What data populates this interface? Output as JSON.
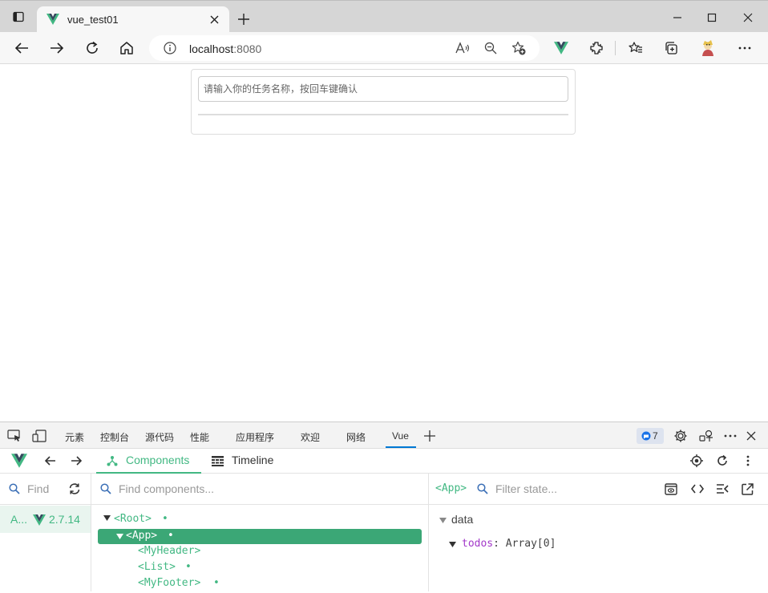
{
  "browser": {
    "tab_title": "vue_test01",
    "url_host": "localhost",
    "url_port": ":8080"
  },
  "page": {
    "todo_placeholder": "请输入你的任务名称，按回车键确认"
  },
  "devtools": {
    "tabs": [
      "元素",
      "控制台",
      "源代码",
      "性能",
      "应用程序",
      "欢迎",
      "网络",
      "Vue"
    ],
    "issues_count": "7",
    "vue": {
      "nav_tabs": {
        "components": "Components",
        "timeline": "Timeline"
      },
      "left": {
        "find": "Find",
        "app_label": "A...",
        "version": "2.7.14"
      },
      "middle": {
        "find_placeholder": "Find components...",
        "tree": [
          {
            "name": "<Root>",
            "dot": "•"
          },
          {
            "name": "<App>",
            "dot": "•"
          },
          {
            "name": "<MyHeader>",
            "dot": ""
          },
          {
            "name": "<List>",
            "dot": "•"
          },
          {
            "name": "<MyFooter>",
            "dot": "•"
          }
        ]
      },
      "right": {
        "selected": "<App>",
        "filter_placeholder": "Filter state...",
        "section": "data",
        "key": "todos",
        "colon": ":",
        "value": "Array[0]"
      }
    }
  },
  "colors": {
    "vue_green": "#42b883",
    "selected_row": "#3ba776",
    "accent_blue": "#0078d4"
  }
}
